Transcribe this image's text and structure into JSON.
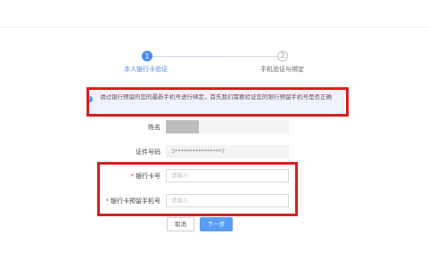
{
  "stepper": {
    "steps": [
      {
        "number": "1",
        "label": "本人银行卡验证",
        "state": "active"
      },
      {
        "number": "2",
        "label": "手机验证与绑定",
        "state": "inactive"
      }
    ]
  },
  "notice": {
    "text": "请过银行预留的您的最新手机号进行绑定，首先我们需要验证您的银行预留手机号是否正确"
  },
  "form": {
    "name": {
      "label": "姓名",
      "value": ""
    },
    "id_number": {
      "label": "证件号码",
      "value": "3****************7"
    },
    "card_number": {
      "required_mark": "*",
      "label": "银行卡号",
      "placeholder": "请输入"
    },
    "card_phone": {
      "required_mark": "*",
      "label": "银行卡预留手机号",
      "placeholder": "请输入"
    }
  },
  "buttons": {
    "cancel_label": "取消",
    "next_label": "下一步"
  },
  "colors": {
    "accent": "#4a8af4",
    "highlight_border": "#d61f1f"
  }
}
